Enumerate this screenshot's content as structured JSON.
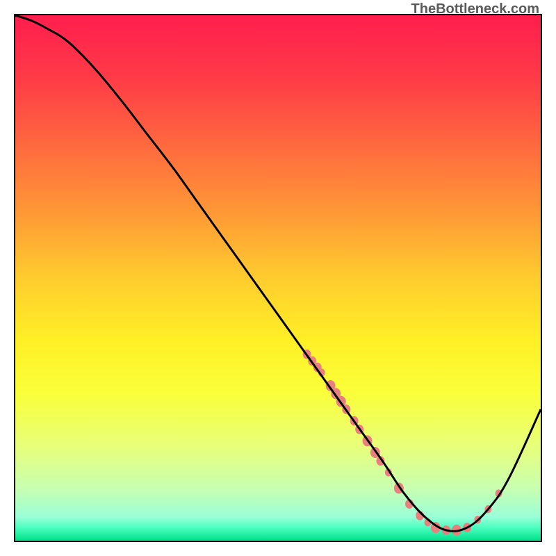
{
  "watermark": "TheBottleneck.com",
  "colors": {
    "gradient_stops": [
      {
        "offset": 0.0,
        "color": "#ff1e4e"
      },
      {
        "offset": 0.12,
        "color": "#ff3b47"
      },
      {
        "offset": 0.25,
        "color": "#ff6a3e"
      },
      {
        "offset": 0.38,
        "color": "#ff9a36"
      },
      {
        "offset": 0.5,
        "color": "#ffcc2e"
      },
      {
        "offset": 0.62,
        "color": "#fff026"
      },
      {
        "offset": 0.72,
        "color": "#f9ff3a"
      },
      {
        "offset": 0.82,
        "color": "#e8ff7a"
      },
      {
        "offset": 0.9,
        "color": "#c8ffb0"
      },
      {
        "offset": 0.955,
        "color": "#9affd8"
      },
      {
        "offset": 0.975,
        "color": "#4bffc0"
      },
      {
        "offset": 1.0,
        "color": "#00e08a"
      }
    ],
    "curve_stroke": "#000000",
    "marker_fill": "#e98080",
    "marker_stroke": "#e98080"
  },
  "chart_data": {
    "type": "line",
    "title": "",
    "xlabel": "",
    "ylabel": "",
    "xlim": [
      0,
      100
    ],
    "ylim": [
      0,
      100
    ],
    "series": [
      {
        "name": "curve",
        "x": [
          0,
          3,
          6,
          10,
          15,
          20,
          25,
          30,
          35,
          40,
          45,
          50,
          55,
          60,
          65,
          70,
          74,
          78,
          82,
          86,
          90,
          94,
          100
        ],
        "y": [
          100,
          99,
          97.5,
          95,
          90,
          84,
          77.5,
          71,
          64,
          57,
          50,
          43,
          36,
          29,
          22,
          15,
          9,
          4.5,
          2,
          2.5,
          6,
          12,
          25
        ]
      }
    ],
    "markers": [
      {
        "x": 55.5,
        "y": 35.5,
        "r": 6
      },
      {
        "x": 56.5,
        "y": 34.2,
        "r": 6
      },
      {
        "x": 57.5,
        "y": 33.0,
        "r": 6
      },
      {
        "x": 58.3,
        "y": 32.0,
        "r": 5
      },
      {
        "x": 60.0,
        "y": 29.5,
        "r": 7
      },
      {
        "x": 61.0,
        "y": 28.0,
        "r": 7
      },
      {
        "x": 62.0,
        "y": 26.5,
        "r": 7
      },
      {
        "x": 63.0,
        "y": 25.0,
        "r": 6
      },
      {
        "x": 64.5,
        "y": 22.8,
        "r": 6
      },
      {
        "x": 65.5,
        "y": 21.2,
        "r": 6
      },
      {
        "x": 67.0,
        "y": 19.0,
        "r": 7
      },
      {
        "x": 68.5,
        "y": 16.8,
        "r": 7
      },
      {
        "x": 69.5,
        "y": 15.2,
        "r": 6
      },
      {
        "x": 71.0,
        "y": 13.0,
        "r": 5
      },
      {
        "x": 73.0,
        "y": 10.0,
        "r": 7
      },
      {
        "x": 75.0,
        "y": 7.0,
        "r": 6
      },
      {
        "x": 77.0,
        "y": 4.8,
        "r": 6
      },
      {
        "x": 78.5,
        "y": 3.5,
        "r": 5
      },
      {
        "x": 80.0,
        "y": 2.5,
        "r": 7
      },
      {
        "x": 82.0,
        "y": 2.0,
        "r": 6
      },
      {
        "x": 84.0,
        "y": 2.0,
        "r": 7
      },
      {
        "x": 86.0,
        "y": 2.5,
        "r": 6
      },
      {
        "x": 88.0,
        "y": 4.0,
        "r": 5
      },
      {
        "x": 90.0,
        "y": 6.0,
        "r": 5
      },
      {
        "x": 92.0,
        "y": 9.0,
        "r": 5
      }
    ]
  }
}
